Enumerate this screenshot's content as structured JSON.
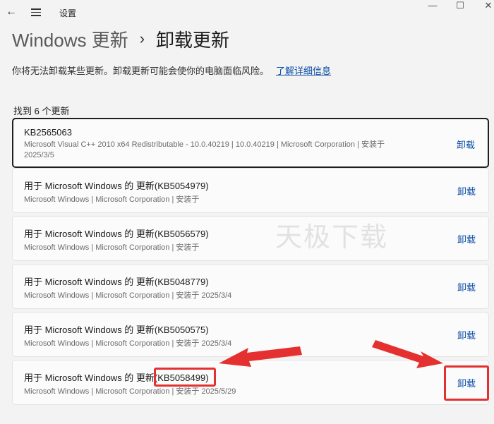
{
  "titlebar": {
    "back_glyph": "←",
    "title": "设置",
    "min_glyph": "—",
    "max_glyph": "☐",
    "close_glyph": "✕"
  },
  "header": {
    "breadcrumb_root": "Windows 更新",
    "separator": "›",
    "current": "卸载更新"
  },
  "description": {
    "text": "你将无法卸载某些更新。卸载更新可能会使你的电脑面临风险。",
    "link": "了解详细信息"
  },
  "count_text": "找到 6 个更新",
  "updates": [
    {
      "title": "KB2565063",
      "meta": "Microsoft Visual C++ 2010  x64 Redistributable - 10.0.40219   |   10.0.40219   |   Microsoft Corporation   |   安装于 2025/3/5",
      "action": "卸载"
    },
    {
      "title": "用于 Microsoft Windows 的 更新(KB5054979)",
      "meta": "Microsoft Windows   |   Microsoft Corporation   |   安装于",
      "action": "卸载"
    },
    {
      "title": "用于 Microsoft Windows 的 更新(KB5056579)",
      "meta": "Microsoft Windows   |   Microsoft Corporation   |   安装于",
      "action": "卸载"
    },
    {
      "title": "用于 Microsoft Windows 的 更新(KB5048779)",
      "meta": "Microsoft Windows   |   Microsoft Corporation   |   安装于 2025/3/4",
      "action": "卸载"
    },
    {
      "title": "用于 Microsoft Windows 的 更新(KB5050575)",
      "meta": "Microsoft Windows   |   Microsoft Corporation   |   安装于 2025/3/4",
      "action": "卸载"
    },
    {
      "title": "用于 Microsoft Windows 的 更新(KB5058499)",
      "meta": "Microsoft Windows   |   Microsoft Corporation   |   安装于 2025/5/29",
      "action": "卸载"
    }
  ],
  "watermark": "天极下载",
  "colors": {
    "accent": "#0a4ea6",
    "annotation": "#e53030"
  }
}
